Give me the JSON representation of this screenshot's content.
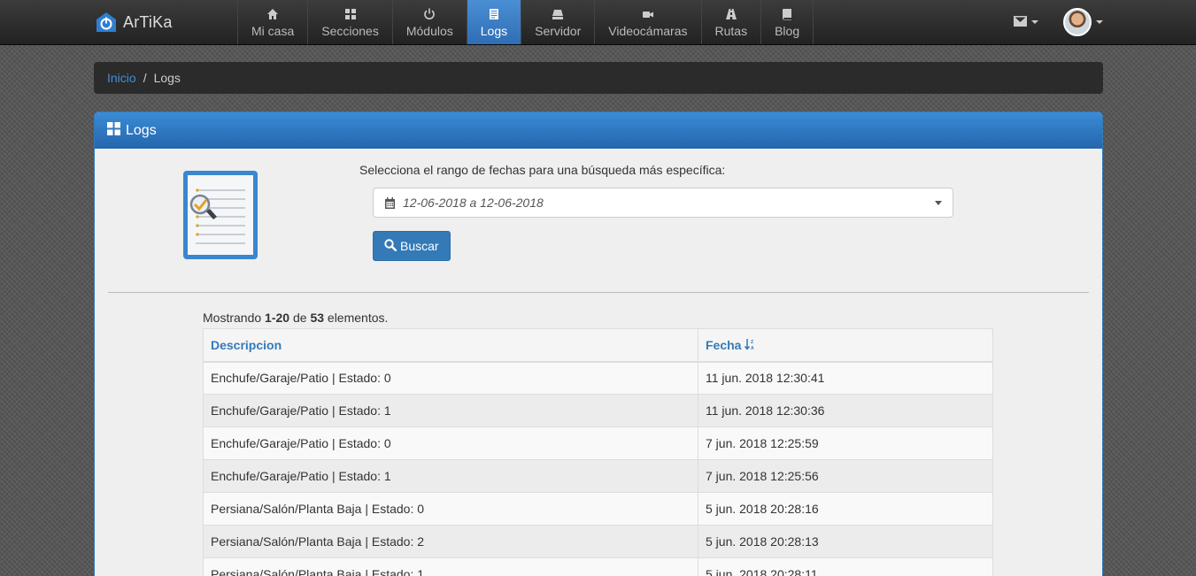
{
  "app": {
    "name": "ArTiKa"
  },
  "nav": {
    "items": [
      {
        "label": "Mi casa",
        "icon": "home-icon"
      },
      {
        "label": "Secciones",
        "icon": "grid-icon"
      },
      {
        "label": "Módulos",
        "icon": "power-icon"
      },
      {
        "label": "Logs",
        "icon": "list-icon",
        "active": true
      },
      {
        "label": "Servidor",
        "icon": "server-icon"
      },
      {
        "label": "Videocámaras",
        "icon": "camera-icon"
      },
      {
        "label": "Rutas",
        "icon": "road-icon"
      },
      {
        "label": "Blog",
        "icon": "book-icon"
      }
    ]
  },
  "breadcrumb": {
    "home": "Inicio",
    "separator": "/",
    "current": "Logs"
  },
  "panel": {
    "title": "Logs",
    "range_label": "Selecciona el rango de fechas para una búsqueda más específica:",
    "date_range": "12-06-2018 a 12-06-2018",
    "search_button": "Buscar"
  },
  "summary": {
    "prefix": "Mostrando",
    "range": "1-20",
    "of": "de",
    "total": "53",
    "suffix": "elementos."
  },
  "table": {
    "headers": {
      "description": "Descripcion",
      "date": "Fecha"
    },
    "rows": [
      {
        "description": "Enchufe/Garaje/Patio | Estado: 0",
        "date": "11 jun. 2018 12:30:41"
      },
      {
        "description": "Enchufe/Garaje/Patio | Estado: 1",
        "date": "11 jun. 2018 12:30:36"
      },
      {
        "description": "Enchufe/Garaje/Patio | Estado: 0",
        "date": "7 jun. 2018 12:25:59"
      },
      {
        "description": "Enchufe/Garaje/Patio | Estado: 1",
        "date": "7 jun. 2018 12:25:56"
      },
      {
        "description": "Persiana/Salón/Planta Baja | Estado: 0",
        "date": "5 jun. 2018 20:28:16"
      },
      {
        "description": "Persiana/Salón/Planta Baja | Estado: 2",
        "date": "5 jun. 2018 20:28:13"
      },
      {
        "description": "Persiana/Salón/Planta Baja | Estado: 1",
        "date": "5 jun. 2018 20:28:11"
      }
    ]
  },
  "colors": {
    "accent": "#337ab7",
    "navbar": "#2b2b2b",
    "link": "#3d8fd8"
  }
}
